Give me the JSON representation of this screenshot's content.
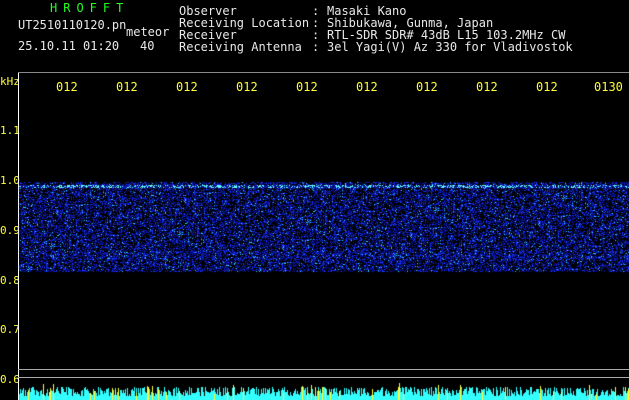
{
  "header": {
    "app_title": "HROFFT",
    "filename": "UT2510110120.pn",
    "meteor_label": "meteor",
    "date_time": "25.10.11 01:20",
    "count_value": "40"
  },
  "info": [
    {
      "label": "Observer",
      "value": "Masaki Kano"
    },
    {
      "label": "Receiving Location",
      "value": "Shibukawa, Gunma, Japan"
    },
    {
      "label": "Receiver",
      "value": "RTL-SDR SDR# 43dB L15 103.2MHz CW"
    },
    {
      "label": "Receiving Antenna",
      "value": "3el Yagi(V) Az 330 for Vladivostok"
    }
  ],
  "axis": {
    "unit": "kHz",
    "y_ticks": [
      "1.1",
      "1.0",
      "0.9",
      "0.8",
      "0.7",
      "0.6"
    ],
    "x_ticks": [
      "012",
      "012",
      "012",
      "012",
      "012",
      "012",
      "012",
      "012",
      "012",
      "0130"
    ]
  },
  "colors": {
    "background": "#000000",
    "title_green": "#22ff22",
    "text_white": "#e8e8e8",
    "tick_yellow": "#ffff33",
    "signal_blue": "#1a33ff",
    "signal_cyan": "#33ffff"
  }
}
